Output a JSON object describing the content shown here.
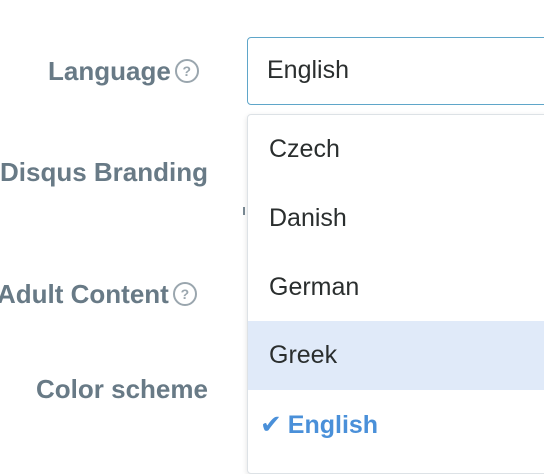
{
  "form": {
    "language_label": "Language",
    "disqus_branding_label": "Disqus Branding",
    "adult_content_label": "Adult Content",
    "color_scheme_label": "Color scheme",
    "help_glyph": "?"
  },
  "language_select": {
    "value": "English"
  },
  "dropdown": {
    "options": [
      {
        "label": "Czech",
        "state": "normal"
      },
      {
        "label": "Danish",
        "state": "normal"
      },
      {
        "label": "German",
        "state": "normal"
      },
      {
        "label": "Greek",
        "state": "hovered"
      },
      {
        "label": "English",
        "state": "selected"
      }
    ],
    "check_glyph": "✔"
  },
  "colors": {
    "label": "#687a86",
    "select_border": "#5fa6c9",
    "hover_bg": "#e0eaf9",
    "selected_text": "#4a90d9"
  }
}
